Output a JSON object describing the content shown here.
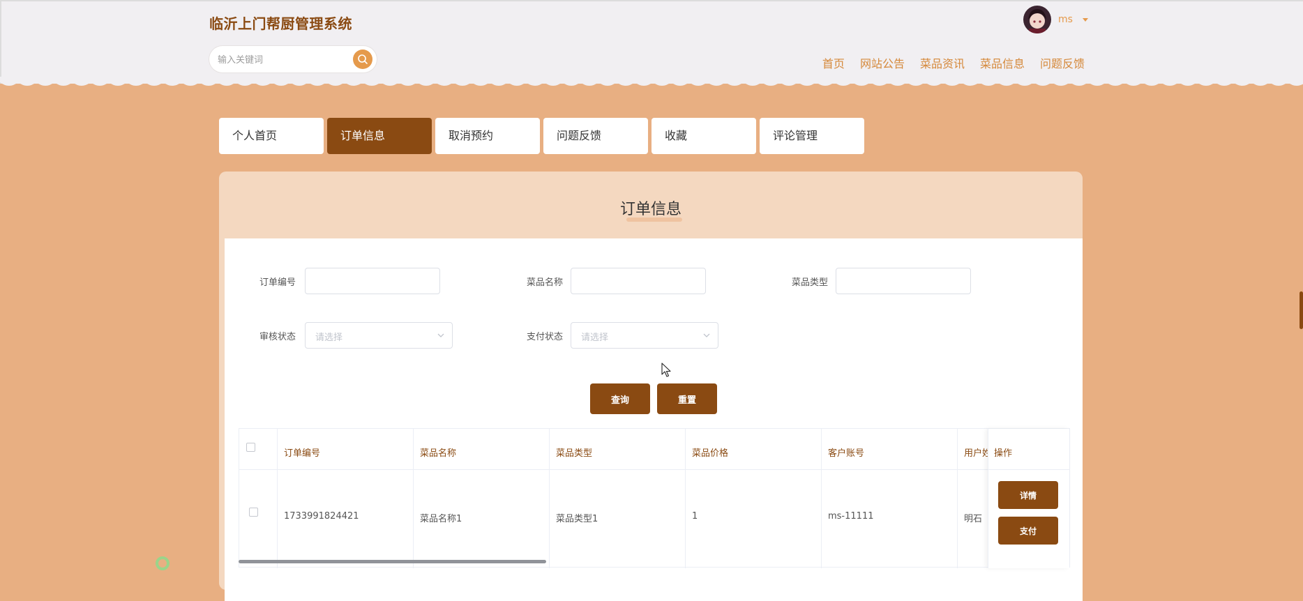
{
  "site": {
    "title": "临沂上门帮厨管理系统"
  },
  "search": {
    "placeholder": "输入关键词"
  },
  "user": {
    "name": "ms"
  },
  "nav": [
    {
      "label": "首页"
    },
    {
      "label": "网站公告"
    },
    {
      "label": "菜品资讯"
    },
    {
      "label": "菜品信息"
    },
    {
      "label": "问题反馈"
    }
  ],
  "tabs": [
    {
      "label": "个人首页",
      "active": false
    },
    {
      "label": "订单信息",
      "active": true
    },
    {
      "label": "取消预约",
      "active": false
    },
    {
      "label": "问题反馈",
      "active": false
    },
    {
      "label": "收藏",
      "active": false
    },
    {
      "label": "评论管理",
      "active": false
    }
  ],
  "panel": {
    "title": "订单信息"
  },
  "filters": {
    "order_no": {
      "label": "订单编号",
      "value": ""
    },
    "dish_name": {
      "label": "菜品名称",
      "value": ""
    },
    "dish_type": {
      "label": "菜品类型",
      "value": ""
    },
    "audit_status": {
      "label": "审核状态",
      "placeholder": "请选择"
    },
    "pay_status": {
      "label": "支付状态",
      "placeholder": "请选择"
    }
  },
  "buttons": {
    "query": "查询",
    "reset": "重置"
  },
  "table": {
    "columns": [
      "订单编号",
      "菜品名称",
      "菜品类型",
      "菜品价格",
      "客户账号",
      "用户姓",
      "操作"
    ],
    "rows": [
      {
        "order_no": "1733991824421",
        "dish_name": "菜品名称1",
        "dish_type": "菜品类型1",
        "price": "1",
        "account": "ms-11111",
        "user_name": "明石",
        "actions": {
          "detail": "详情",
          "pay": "支付"
        }
      }
    ]
  },
  "colors": {
    "accent": "#8a4a12",
    "background": "#e8af82",
    "nav_link": "#d5883a",
    "search_button": "#e59a4c"
  }
}
